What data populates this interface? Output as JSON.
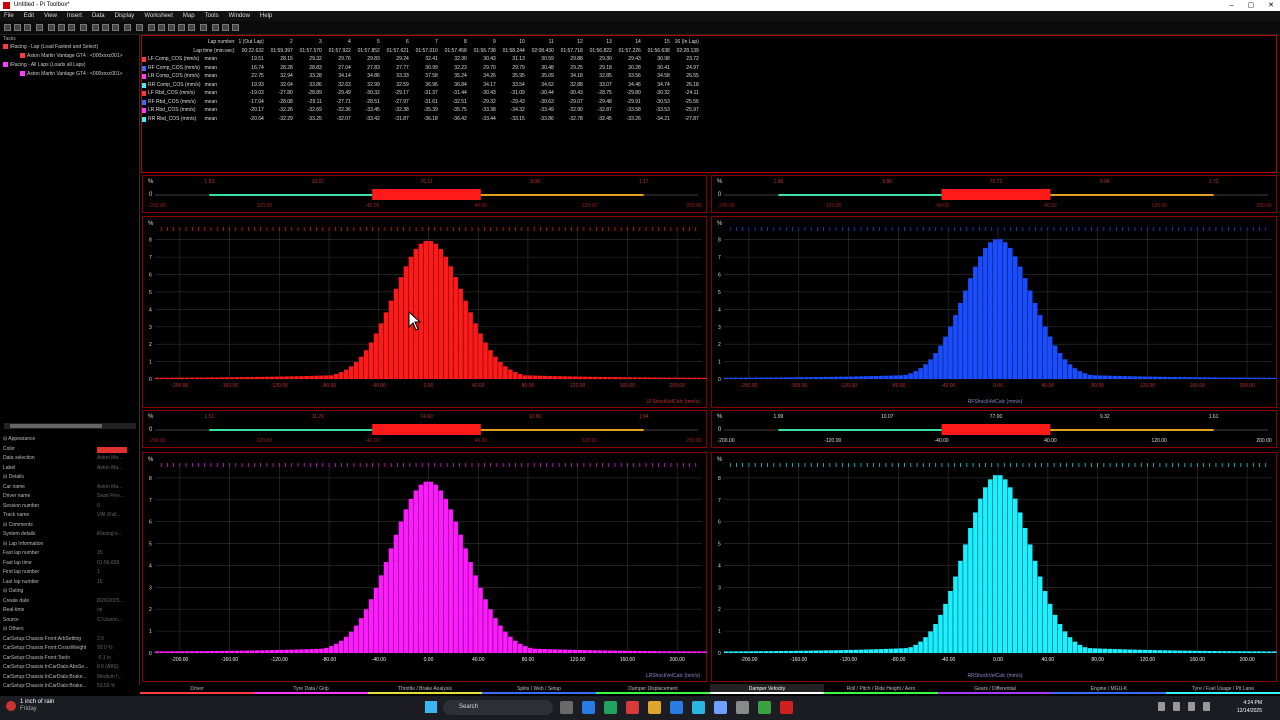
{
  "window": {
    "title": "Untitled - Pi Toolbox*",
    "buttons": [
      "–",
      "▢",
      "✕"
    ]
  },
  "menu": [
    "File",
    "Edit",
    "View",
    "Insert",
    "Data",
    "Display",
    "Worksheet",
    "Map",
    "Tools",
    "Window",
    "Help"
  ],
  "left": {
    "tasks_label": "Tasks",
    "tree": [
      {
        "label": "iRacing - Lap (Load Fastest and Select)",
        "color": "#ff3b3b"
      },
      {
        "label": "Aston Martin Vantage GT4 : <000xxxc001>",
        "color": "#ff3b3b",
        "indent": true
      },
      {
        "label": "iRacing - All Laps (Loads all Laps)",
        "color": "#ff3bff"
      },
      {
        "label": "Aston Martin Vantage GT4 : <000xxxc001>",
        "color": "#ff3bff",
        "indent": true
      }
    ],
    "properties": [
      {
        "k": "Appearance",
        "sec": true
      },
      {
        "k": "Color",
        "v": "",
        "swatch": "#e03030"
      },
      {
        "k": "Data selection",
        "v": "Aston Ma..."
      },
      {
        "k": "Label",
        "v": "Aston Ma..."
      },
      {
        "k": "Details",
        "sec": true
      },
      {
        "k": "Car name",
        "v": "Aston Ma..."
      },
      {
        "k": "Driver name",
        "v": "Sean Finn..."
      },
      {
        "k": "Session number",
        "v": "0"
      },
      {
        "k": "Track name",
        "v": "VIR (Full..."
      },
      {
        "k": "Comments",
        "sec": true
      },
      {
        "k": "System details",
        "v": "iRacing v..."
      },
      {
        "k": "Lap Information",
        "sec": true
      },
      {
        "k": "Fast lap number",
        "v": "15"
      },
      {
        "k": "Fast lap time",
        "v": "01:56.638"
      },
      {
        "k": "First lap number",
        "v": "1"
      },
      {
        "k": "Last lap number",
        "v": "16"
      },
      {
        "k": "Outing",
        "sec": true
      },
      {
        "k": "Create date",
        "v": "8/26/2025..."
      },
      {
        "k": "Real-time",
        "v": "no"
      },
      {
        "k": "Source",
        "v": "C:\\Users\\..."
      },
      {
        "k": "Others",
        "sec": true
      },
      {
        "k": "CarSetup:Chassis:Front:ArbSetting",
        "v": "2.0"
      },
      {
        "k": "CarSetup:Chassis:Front:CrossWeight",
        "v": "50.0 %"
      },
      {
        "k": "CarSetup:Chassis:Front:ToeIn",
        "v": "-0.1 in"
      },
      {
        "k": "CarSetup:Chassis:InCarDials:AbsSe...",
        "v": "8.0 (ABS)"
      },
      {
        "k": "CarSetup:Chassis:InCarDials:Brake...",
        "v": "Medium f..."
      },
      {
        "k": "CarSetup:Chassis:InCarDials:Brake...",
        "v": "53.50 %"
      }
    ]
  },
  "lap_table": {
    "header1": [
      "Lap number",
      "1 (Out Lap)",
      "2",
      "3",
      "4",
      "5",
      "6",
      "7",
      "8",
      "9",
      "10",
      "11",
      "12",
      "13",
      "14",
      "15",
      "16 (In Lap)"
    ],
    "header2": [
      "Lap time (min:sec)",
      "00:22.632",
      "01:59.397",
      "01:57.570",
      "01:57.922",
      "01:57.852",
      "01:57.621",
      "01:57.010",
      "01:57.458",
      "01:56.738",
      "01:58.244",
      "02:08.430",
      "01:57.718",
      "01:56.822",
      "01:57.226",
      "01:56.638",
      "02:28.139"
    ],
    "rows": [
      {
        "name": "LF Comp_COS (mm/s)",
        "stat": "mean",
        "color": "#ff3b3b",
        "vals": [
          "19.51",
          "28.15",
          "29.32",
          "29.76",
          "29.83",
          "29.24",
          "32.41",
          "32.30",
          "30.43",
          "31.13",
          "30.59",
          "29.88",
          "29.30",
          "29.43",
          "30.98",
          "23.72"
        ]
      },
      {
        "name": "RF Comp_COS (mm/s)",
        "stat": "mean",
        "color": "#3b6bff",
        "vals": [
          "16.74",
          "28.28",
          "28.83",
          "27.04",
          "27.83",
          "27.77",
          "30.99",
          "32.23",
          "29.70",
          "29.79",
          "30.48",
          "29.25",
          "29.18",
          "30.28",
          "30.41",
          "24.97"
        ]
      },
      {
        "name": "LR Comp_COS (mm/s)",
        "stat": "mean",
        "color": "#ff3bff",
        "vals": [
          "22.75",
          "32.94",
          "33.28",
          "34.14",
          "34.86",
          "33.33",
          "37.58",
          "35.24",
          "34.26",
          "35.95",
          "35.09",
          "34.18",
          "32.85",
          "33.56",
          "34.58",
          "26.55"
        ]
      },
      {
        "name": "RR Comp_COS (mm/s)",
        "stat": "mean",
        "color": "#3bf0ff",
        "vals": [
          "19.93",
          "32.64",
          "33.86",
          "32.63",
          "32.99",
          "32.59",
          "36.96",
          "36.84",
          "34.17",
          "33.54",
          "34.62",
          "32.88",
          "33.07",
          "34.46",
          "34.74",
          "26.18"
        ]
      },
      {
        "name": "LF Rbd_COS (mm/s)",
        "stat": "mean",
        "color": "#ff3b3b",
        "vals": [
          "-19.03",
          "-27.80",
          "-28.89",
          "-29.49",
          "-30.32",
          "-29.17",
          "-31.37",
          "-31.44",
          "-30.43",
          "-31.09",
          "-30.44",
          "-30.43",
          "-28.75",
          "-29.80",
          "-30.32",
          "-24.11"
        ]
      },
      {
        "name": "RF Rbd_COS (mm/s)",
        "stat": "mean",
        "color": "#3b6bff",
        "vals": [
          "-17.04",
          "-28.08",
          "-29.11",
          "-27.71",
          "-28.51",
          "-27.97",
          "-31.61",
          "-32.51",
          "-29.32",
          "-29.43",
          "-30.63",
          "-29.07",
          "-29.48",
          "-29.91",
          "-30.53",
          "-25.56"
        ]
      },
      {
        "name": "LR Rbd_COS (mm/s)",
        "stat": "mean",
        "color": "#ff3bff",
        "vals": [
          "-20.17",
          "-32.26",
          "-32.69",
          "-32.36",
          "-33.45",
          "-32.38",
          "-35.39",
          "-35.75",
          "-33.38",
          "-34.32",
          "-33.49",
          "-32.90",
          "-32.87",
          "-33.58",
          "-33.53",
          "-25.97"
        ]
      },
      {
        "name": "RR Rbd_COS (mm/s)",
        "stat": "mean",
        "color": "#3bf0ff",
        "vals": [
          "-20.64",
          "-32.29",
          "-33.25",
          "-32.07",
          "-33.42",
          "-31.87",
          "-36.18",
          "-36.42",
          "-33.44",
          "-33.15",
          "-33.86",
          "-32.78",
          "-32.45",
          "-33.26",
          "-34.21",
          "-27.87"
        ]
      }
    ]
  },
  "scales": [
    {
      "id": "tl",
      "labels": [
        "1.53",
        "10.07",
        "76.11",
        "9.08",
        "1.17"
      ],
      "ticks": [
        "-200.00",
        "-120.00",
        "-40.00",
        "40.00",
        "120.00",
        "200.00"
      ],
      "pct": "%",
      "zero": "0"
    },
    {
      "id": "tr",
      "labels": [
        "1.90",
        "9.80",
        "76.72",
        "9.84",
        "1.73"
      ],
      "ticks": [
        "-200.00",
        "-120.00",
        "-40.00",
        "40.00",
        "120.00",
        "200.00"
      ],
      "pct": "%",
      "zero": "0"
    },
    {
      "id": "bl",
      "labels": [
        "1.51",
        "11.20",
        "74.60",
        "10.80",
        "1.94"
      ],
      "ticks": [
        "-200.00",
        "-120.00",
        "-40.00",
        "40.00",
        "120.00",
        "200.00"
      ],
      "pct": "%",
      "zero": "0"
    },
    {
      "id": "br",
      "labels": [
        "1.99",
        "10.07",
        "77.00",
        "9.32",
        "1.61"
      ],
      "ticks": [
        "-200.00",
        "-120.00",
        "-40.00",
        "40.00",
        "120.00",
        "200.00"
      ],
      "pct": "%",
      "zero": "0"
    }
  ],
  "chart_data": [
    {
      "type": "bar",
      "name": "LF",
      "color": "#ff1a1a",
      "xlabel": "LFShockVelCalc (mm/s)",
      "xticks": [
        "-200.00",
        "-160.00",
        "-120.00",
        "-80.00",
        "-40.00",
        "0.00",
        "40.00",
        "80.00",
        "120.00",
        "160.00",
        "200.00"
      ],
      "yticks": [
        "0",
        "1",
        "2",
        "3",
        "4",
        "5",
        "6",
        "7",
        "8"
      ],
      "ylabel": "%",
      "peak": 7.9,
      "center": 0,
      "sigma": 28
    },
    {
      "type": "bar",
      "name": "RF",
      "color": "#1a4dff",
      "xlabel": "RFShockVelCalc (mm/s)",
      "xticks": [
        "-200.00",
        "-160.00",
        "-120.00",
        "-80.00",
        "-40.00",
        "0.00",
        "40.00",
        "80.00",
        "120.00",
        "160.00",
        "200.00"
      ],
      "yticks": [
        "0",
        "1",
        "2",
        "3",
        "4",
        "5",
        "6",
        "7",
        "8"
      ],
      "ylabel": "%",
      "peak": 8.0,
      "center": 0,
      "sigma": 27
    },
    {
      "type": "bar",
      "name": "LR",
      "color": "#ff1aff",
      "xlabel": "LRShockVelCalc (mm/s)",
      "xticks": [
        "-200.00",
        "-160.00",
        "-120.00",
        "-80.00",
        "-40.00",
        "0.00",
        "40.00",
        "80.00",
        "120.00",
        "160.00",
        "200.00"
      ],
      "yticks": [
        "0",
        "1",
        "2",
        "3",
        "4",
        "5",
        "6",
        "7",
        "8"
      ],
      "ylabel": "%",
      "peak": 7.8,
      "center": 0,
      "sigma": 30
    },
    {
      "type": "bar",
      "name": "RR",
      "color": "#1af0ff",
      "xlabel": "RRShockVelCalc (mm/s)",
      "xticks": [
        "-200.00",
        "-160.00",
        "-120.00",
        "-80.00",
        "-40.00",
        "0.00",
        "40.00",
        "80.00",
        "120.00",
        "160.00",
        "200.00"
      ],
      "yticks": [
        "0",
        "1",
        "2",
        "3",
        "4",
        "5",
        "6",
        "7",
        "8"
      ],
      "ylabel": "%",
      "peak": 8.1,
      "center": 0,
      "sigma": 26
    }
  ],
  "tabs": [
    {
      "label": "Driver",
      "color": "#ff3b3b"
    },
    {
      "label": "Tyre Data / Grip",
      "color": "#ff3bff"
    },
    {
      "label": "Throttle / Brake Analysis",
      "color": "#e0e03b"
    },
    {
      "label": "Splits / Web / Setup",
      "color": "#3b6bff"
    },
    {
      "label": "Damper Displacement",
      "color": "#3bff3b"
    },
    {
      "label": "Damper Velocity",
      "color": "#ffffff"
    },
    {
      "label": "Roll / Pitch / Ride Height / Aero",
      "color": "#3bff3b"
    },
    {
      "label": "Gears / Differential",
      "color": "#a03bff"
    },
    {
      "label": "Engine / MGU-K",
      "color": "#3b6bff"
    },
    {
      "label": "Tyre / Fuel Usage / Pit Lane",
      "color": "#3bf0ff"
    }
  ],
  "taskbar": {
    "weather_line1": "1 inch of rain",
    "weather_line2": "Friday",
    "search": "Search",
    "time": "4:24 PM",
    "date": "12/14/2025",
    "app_colors": [
      "#6a6a6a",
      "#2a7be4",
      "#1fa35f",
      "#d63b3b",
      "#e0a52b",
      "#2a7be4",
      "#2ab4e0",
      "#6fa0ff",
      "#8a8a8a",
      "#3aa040",
      "#d02020"
    ]
  }
}
